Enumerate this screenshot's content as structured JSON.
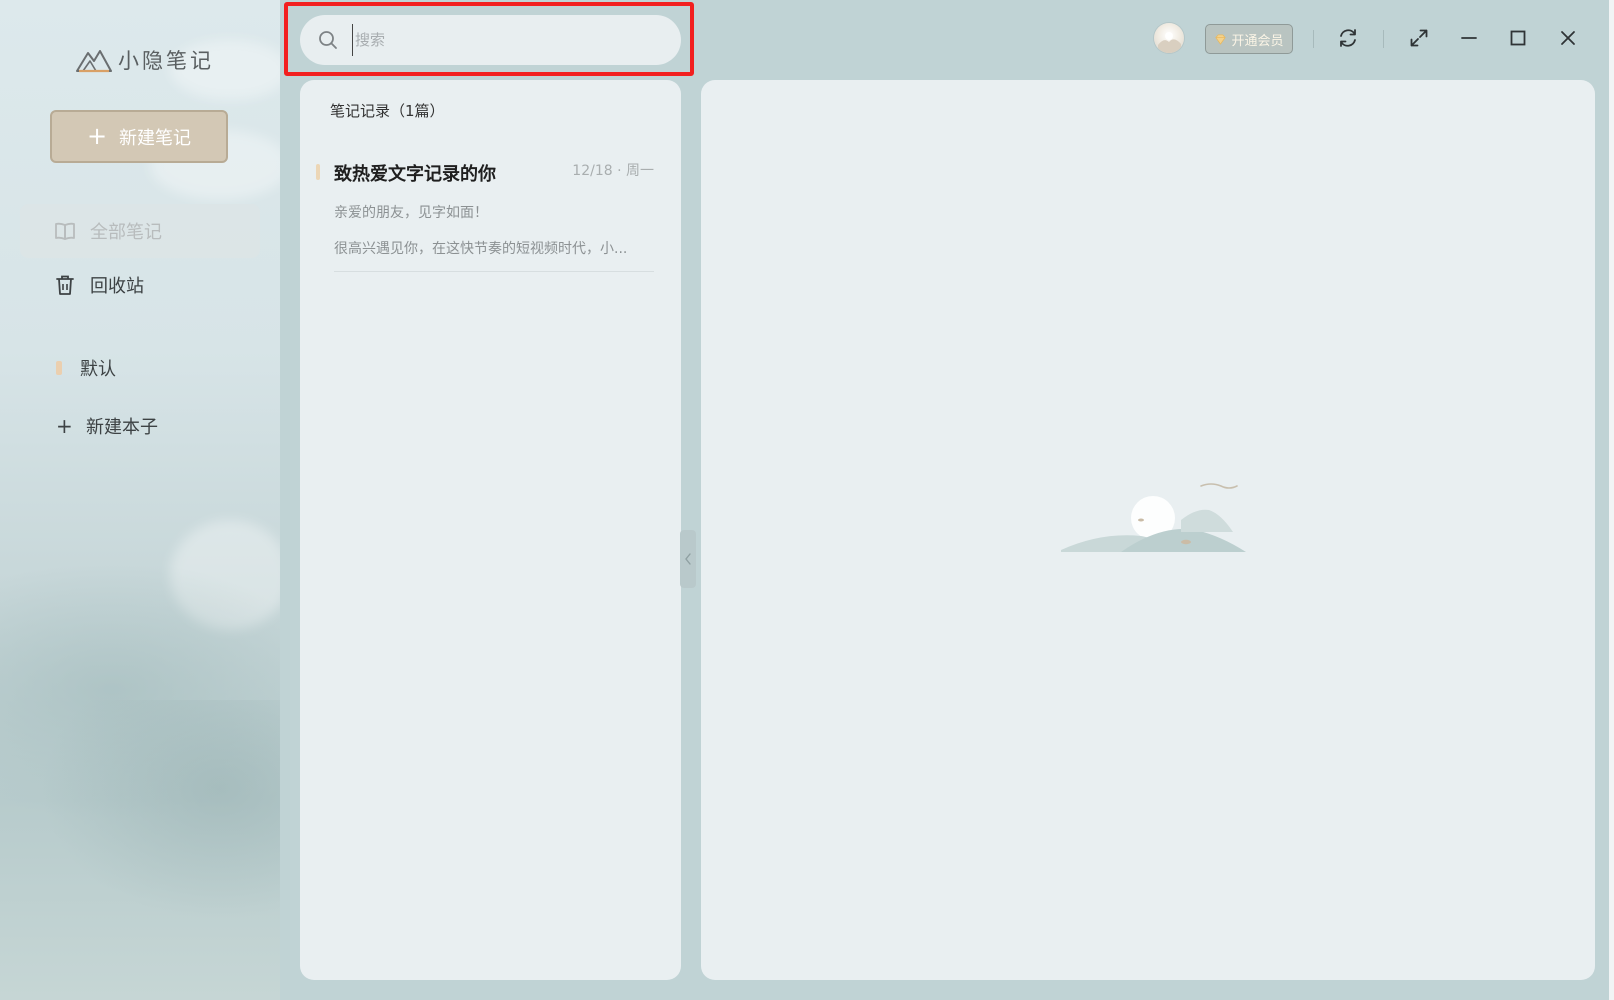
{
  "app": {
    "name": "小隐笔记"
  },
  "sidebar": {
    "new_note_label": "新建笔记",
    "nav": [
      {
        "label": "全部笔记",
        "icon": "book-open-icon",
        "active": true
      },
      {
        "label": "回收站",
        "icon": "trash-icon",
        "active": false
      }
    ],
    "notebooks": [
      {
        "label": "默认",
        "marker_color": "#ebcfaf"
      }
    ],
    "new_notebook_label": "新建本子"
  },
  "search": {
    "placeholder": "搜索",
    "value": ""
  },
  "topbar": {
    "vip_label": "开通会员",
    "icons": [
      "avatar",
      "diamond-icon",
      "sync-icon",
      "expand-icon",
      "minimize-icon",
      "maximize-icon",
      "close-icon"
    ]
  },
  "notes": {
    "header": "笔记记录（1篇）",
    "items": [
      {
        "title": "致热爱文字记录的你",
        "date": "12/18 · 周一",
        "line1": "亲爱的朋友，见字如面！",
        "line2": "很高兴遇见你，在这快节奏的短视频时代，小..."
      }
    ]
  },
  "colors": {
    "accent_red_outline": "#f21f1f",
    "new_note_button": "#d3c8b5",
    "panel_bg": "#e9eff1",
    "window_bg": "#c0d3d5"
  }
}
